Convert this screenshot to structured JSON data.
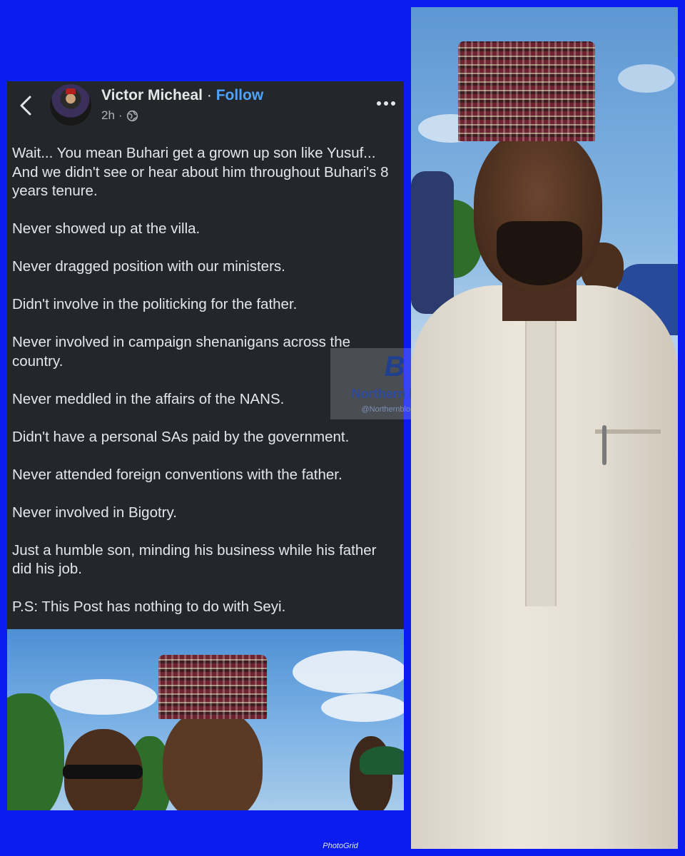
{
  "post": {
    "author_name": "Victor Micheal",
    "separator": "·",
    "follow_label": "Follow",
    "time": "2h",
    "meta_separator": "·",
    "paragraphs": [
      "Wait... You mean Buhari get a grown up son like Yusuf... And we didn't see or hear about him throughout Buhari's 8 years tenure.",
      "Never showed up at the villa.",
      "Never dragged position with our ministers.",
      "Didn't involve in the politicking for the father.",
      "Never involved in campaign shenanigans across the country.",
      "Never meddled in the affairs of the NANS.",
      "Didn't have a personal SAs paid by the government.",
      "Never attended foreign conventions with the father.",
      "Never involved in Bigotry.",
      "Just a humble son, minding his business while his father did his job.",
      "P.S: This Post has nothing to do with Seyi."
    ],
    "icons": {
      "back": "chevron-left-icon",
      "audience": "globe-icon",
      "more": "more-horizontal-icon"
    }
  },
  "watermark": {
    "logo_text": "B",
    "title": "Northern Blog",
    "handle": "@Northernblog___"
  },
  "credit": "PhotoGrid",
  "colors": {
    "background": "#0a1cf0",
    "post_background": "#23272b",
    "follow": "#4da3ff",
    "text": "#e4e6eb"
  }
}
